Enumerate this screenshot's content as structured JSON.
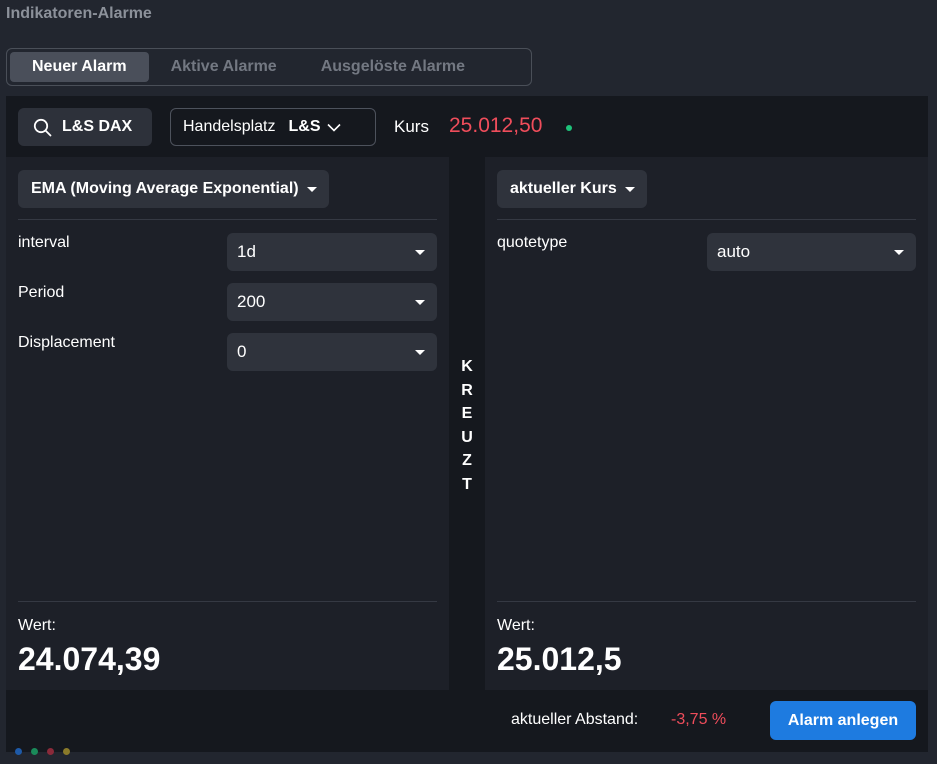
{
  "window": {
    "title": "Indikatoren-Alarme"
  },
  "tabs": [
    {
      "label": "Neuer Alarm",
      "active": true
    },
    {
      "label": "Aktive Alarme",
      "active": false
    },
    {
      "label": "Ausgelöste Alarme",
      "active": false
    }
  ],
  "toolbar": {
    "instrument": "L&S DAX",
    "instrument_icon": "search-icon",
    "market_label": "Handelsplatz",
    "market_value": "L&S",
    "price_label": "Kurs",
    "price_value": "25.012,50",
    "price_color": "#ef4d5b",
    "live_indicator_color": "#1ec27a"
  },
  "left": {
    "indicator": "EMA (Moving Average Exponential)",
    "params": [
      {
        "label": "interval",
        "value": "1d"
      },
      {
        "label": "Period",
        "value": "200"
      },
      {
        "label": "Displacement",
        "value": "0"
      }
    ],
    "value_label": "Wert:",
    "value": "24.074,39"
  },
  "operator": [
    "K",
    "R",
    "E",
    "U",
    "Z",
    "T"
  ],
  "right": {
    "indicator": "aktueller Kurs",
    "params": [
      {
        "label": "quotetype",
        "value": "auto"
      }
    ],
    "value_label": "Wert:",
    "value": "25.012,5"
  },
  "footer": {
    "distance_label": "aktueller Abstand:",
    "distance_value": "-3,75 %",
    "create_label": "Alarm anlegen"
  },
  "colors": {
    "accent": "#1e7be0",
    "negative": "#ef4d5b",
    "positive": "#1ec27a"
  },
  "status_dots": [
    "#1e5aa8",
    "#1a8a5a",
    "#8a2a3a",
    "#8a7a2a"
  ]
}
